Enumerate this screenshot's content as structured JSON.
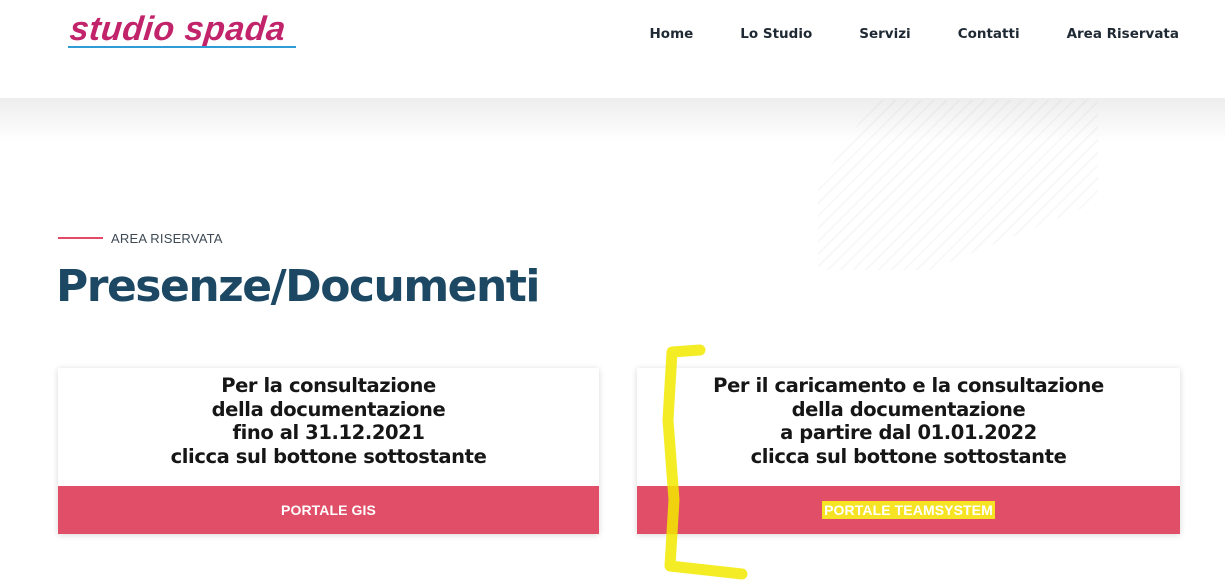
{
  "header": {
    "logo_text": "studio spada",
    "nav": [
      "Home",
      "Lo Studio",
      "Servizi",
      "Contatti",
      "Area Riservata"
    ]
  },
  "section": {
    "eyebrow": "AREA RISERVATA",
    "title": "Presenze/Documenti"
  },
  "cards": [
    {
      "lines": [
        "Per la consultazione",
        "della documentazione",
        "fino al 31.12.2021",
        "clicca sul bottone sottostante"
      ],
      "button": "PORTALE GIS"
    },
    {
      "lines": [
        "Per il caricamento e la consultazione",
        "della documentazione",
        "a partire dal 01.01.2022",
        "clicca sul bottone sottostante"
      ],
      "button": "PORTALE TEAMSYSTEM"
    }
  ],
  "colors": {
    "accent": "#e14e67",
    "title": "#1c4863",
    "logo": "#c2246b",
    "highlight": "#f6e323"
  }
}
